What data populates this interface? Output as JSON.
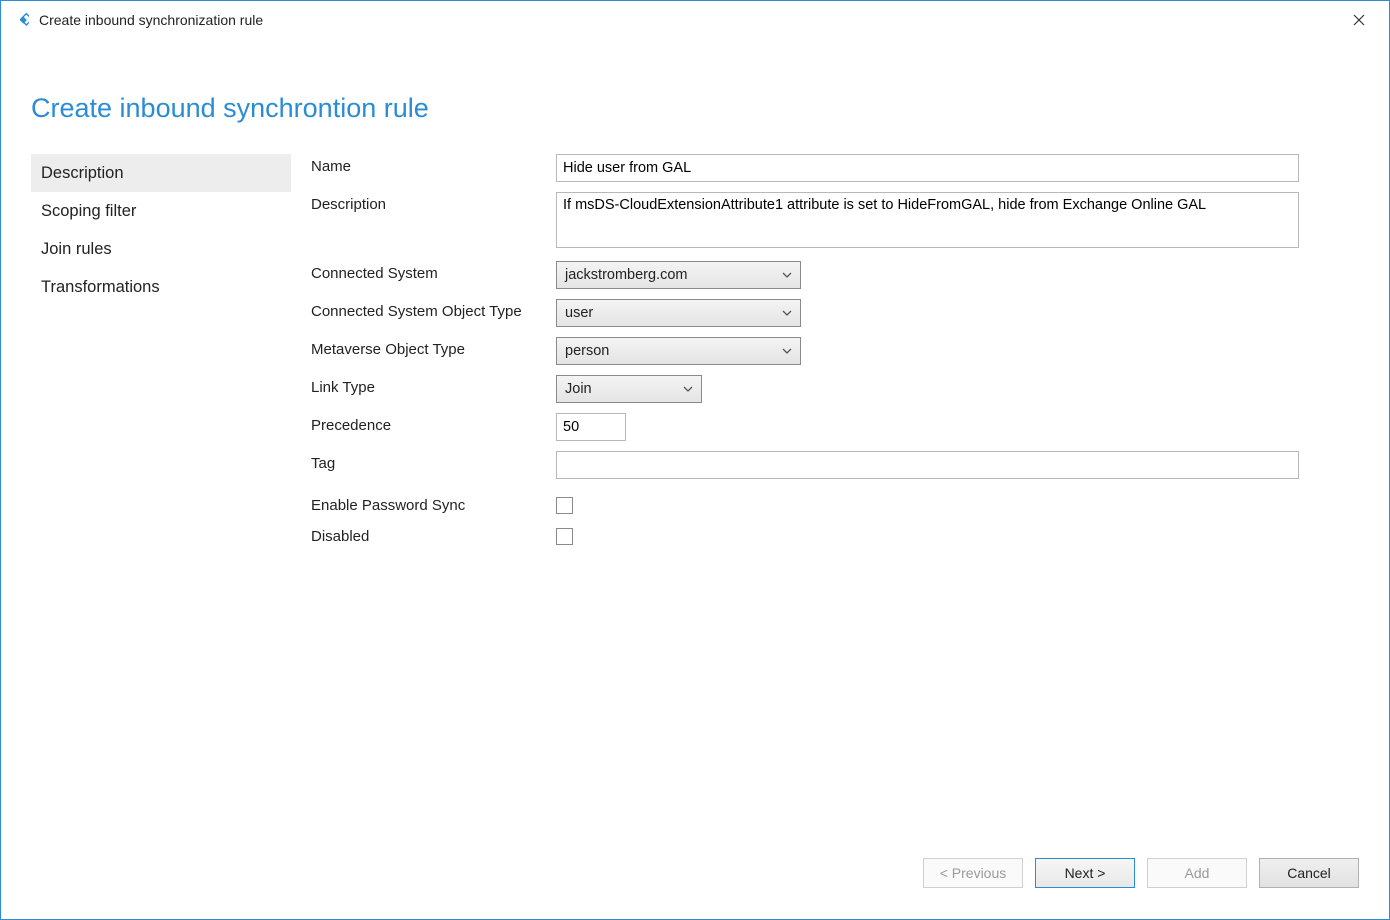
{
  "window": {
    "title": "Create inbound synchronization rule"
  },
  "page": {
    "heading": "Create inbound synchrontion rule"
  },
  "sidebar": {
    "items": [
      {
        "label": "Description",
        "active": true
      },
      {
        "label": "Scoping filter",
        "active": false
      },
      {
        "label": "Join rules",
        "active": false
      },
      {
        "label": "Transformations",
        "active": false
      }
    ]
  },
  "form": {
    "name": {
      "label": "Name",
      "value": "Hide user from GAL"
    },
    "description": {
      "label": "Description",
      "value": "If msDS-CloudExtensionAttribute1 attribute is set to HideFromGAL, hide from Exchange Online GAL"
    },
    "connectedSystem": {
      "label": "Connected System",
      "value": "jackstromberg.com"
    },
    "connectedSystemObjectType": {
      "label": "Connected System Object Type",
      "value": "user"
    },
    "metaverseObjectType": {
      "label": "Metaverse Object Type",
      "value": "person"
    },
    "linkType": {
      "label": "Link Type",
      "value": "Join"
    },
    "precedence": {
      "label": "Precedence",
      "value": "50"
    },
    "tag": {
      "label": "Tag",
      "value": ""
    },
    "enablePasswordSync": {
      "label": "Enable Password Sync",
      "checked": false
    },
    "disabled": {
      "label": "Disabled",
      "checked": false
    }
  },
  "footer": {
    "previous": "< Previous",
    "next": "Next >",
    "add": "Add",
    "cancel": "Cancel"
  }
}
